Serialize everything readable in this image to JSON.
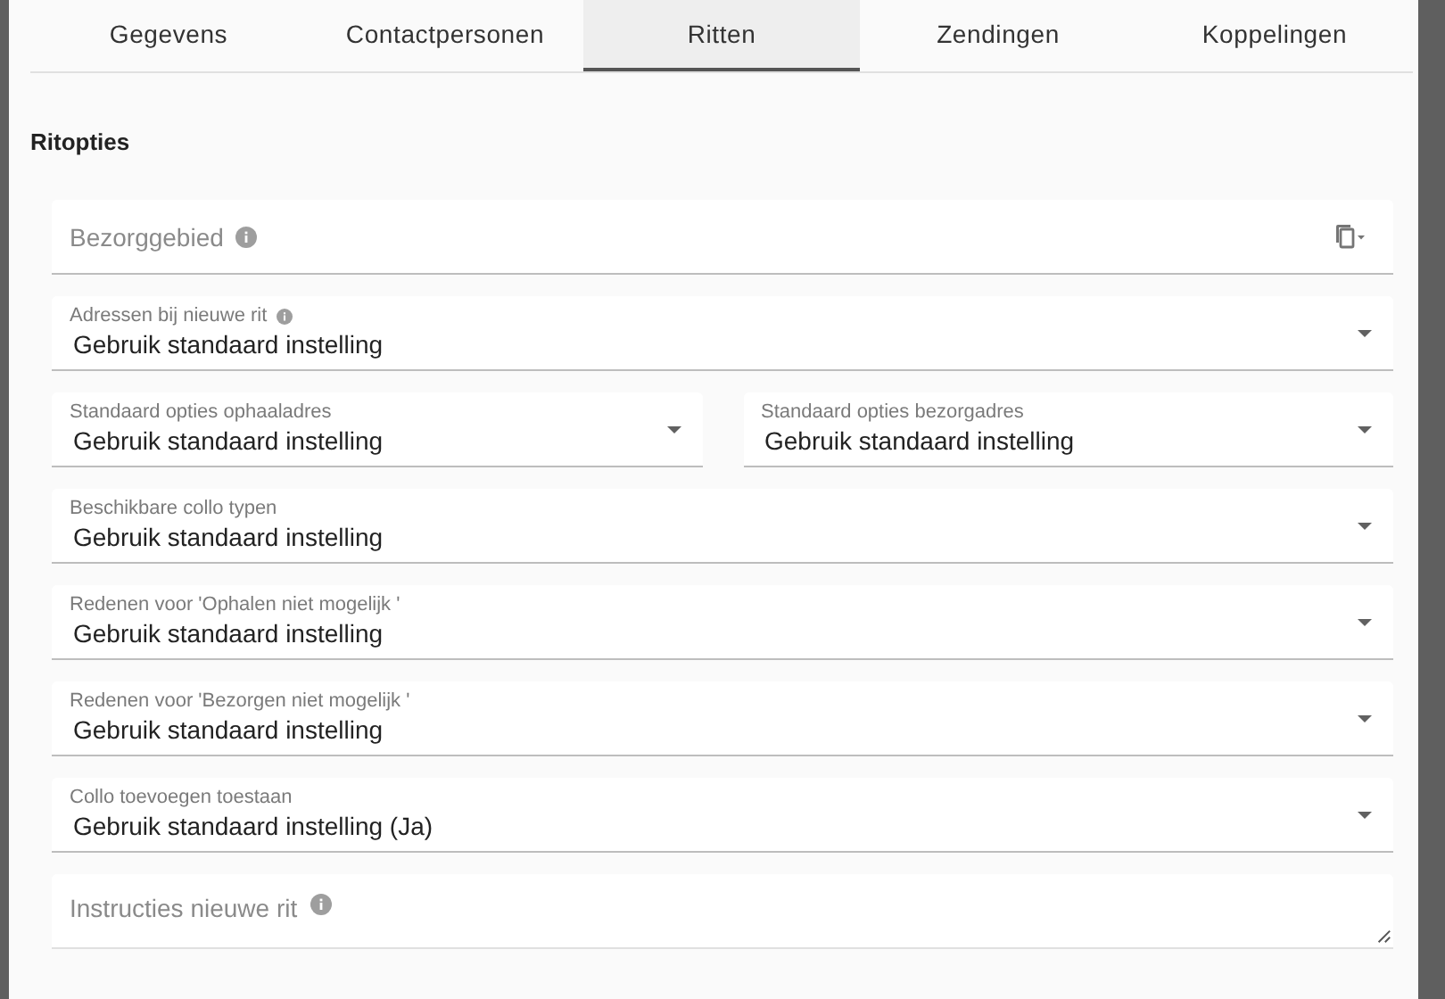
{
  "tabs": [
    {
      "label": "Gegevens",
      "selected": false
    },
    {
      "label": "Contactpersonen",
      "selected": false
    },
    {
      "label": "Ritten",
      "selected": true
    },
    {
      "label": "Zendingen",
      "selected": false
    },
    {
      "label": "Koppelingen",
      "selected": false
    }
  ],
  "section_title": "Ritopties",
  "rows": [
    [
      {
        "kind": "input",
        "placeholder": "Bezorggebied",
        "info": true,
        "copy_menu": true
      }
    ],
    [
      {
        "kind": "select",
        "label": "Adressen bij nieuwe rit",
        "info": true,
        "value": "Gebruik standaard instelling"
      }
    ],
    [
      {
        "kind": "select",
        "label": "Standaard opties ophaaladres",
        "info": false,
        "value": "Gebruik standaard instelling"
      },
      {
        "kind": "select",
        "label": "Standaard opties bezorgadres",
        "info": false,
        "value": "Gebruik standaard instelling"
      }
    ],
    [
      {
        "kind": "select",
        "label": "Beschikbare collo typen",
        "info": false,
        "value": "Gebruik standaard instelling"
      }
    ],
    [
      {
        "kind": "select",
        "label": "Redenen voor 'Ophalen niet mogelijk '",
        "info": false,
        "value": "Gebruik standaard instelling"
      }
    ],
    [
      {
        "kind": "select",
        "label": "Redenen voor 'Bezorgen niet mogelijk '",
        "info": false,
        "value": "Gebruik standaard instelling"
      }
    ],
    [
      {
        "kind": "select",
        "label": "Collo toevoegen toestaan",
        "info": false,
        "value": "Gebruik standaard instelling (Ja)"
      }
    ],
    [
      {
        "kind": "textarea",
        "placeholder": "Instructies nieuwe rit",
        "info": true
      }
    ]
  ]
}
